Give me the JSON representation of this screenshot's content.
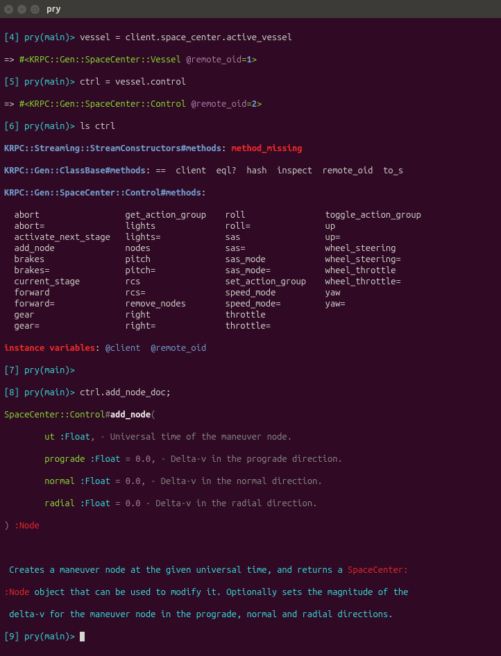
{
  "window": {
    "title": "pry"
  },
  "lines": {
    "p4": "[4] pry(main)> ",
    "p4cmd": "vessel = client.space_center.active_vessel",
    "r4a": "=> ",
    "r4b": "#<KRPC::Gen::SpaceCenter::Vessel ",
    "r4c": "@remote_oid",
    "r4d": "=",
    "r4e": "1",
    "r4f": ">",
    "p5": "[5] pry(main)> ",
    "p5cmd": "ctrl = vessel.control",
    "r5a": "=> ",
    "r5b": "#<KRPC::Gen::SpaceCenter::Control ",
    "r5c": "@remote_oid",
    "r5d": "=",
    "r5e": "2",
    "r5f": ">",
    "p6": "[6] pry(main)> ",
    "p6cmd": "ls ctrl",
    "h1a": "KRPC::Streaming::StreamConstructors#methods",
    "h1b": ": ",
    "h1c": "method_missing",
    "h2a": "KRPC::Gen::ClassBase#methods",
    "h2b": ": ",
    "h2c": "==  client  eql?  hash  inspect  remote_oid  to_s",
    "h3a": "KRPC::Gen::SpaceCenter::Control#methods",
    "h3b": ": ",
    "iva": "instance variables",
    "ivb": ": ",
    "ivc": "@client",
    "ivd": "@remote_oid",
    "p7": "[7] pry(main)> ",
    "p8": "[8] pry(main)> ",
    "p8cmd": "ctrl.add_node_doc;",
    "doc1a": "SpaceCenter::Control",
    "doc1b": "#",
    "doc1c": "add_node",
    "doc1d": "(",
    "pa1a": "        ut ",
    "pa1b": ":Float",
    "pa1c": ", - Universal time of the maneuver node.",
    "pa2a": "        prograde ",
    "pa2b": ":Float",
    "pa2c": " = ",
    "pa2d": "0.0",
    "pa2e": ", - Delta-v in the prograde direction.",
    "pa3a": "        normal ",
    "pa3b": ":Float",
    "pa3c": " = ",
    "pa3d": "0.0",
    "pa3e": ", - Delta-v in the normal direction.",
    "pa4a": "        radial ",
    "pa4b": ":Float",
    "pa4c": " = ",
    "pa4d": "0.0",
    "pa4e": " - Delta-v in the radial direction.",
    "ret1": ") ",
    "ret2": ":Node",
    "desc1": " Creates a maneuver node at the given universal time, and returns a ",
    "desc1b": "SpaceCenter:",
    "desc2a": ":Node",
    "desc2b": " object that can be used to modify it. Optionally sets the magnitude of the",
    "desc3": " delta-v for the maneuver node in the prograde, normal and radial directions.",
    "p9": "[9] pry(main)> "
  },
  "methods": [
    [
      "abort",
      "get_action_group",
      "roll",
      "toggle_action_group"
    ],
    [
      "abort=",
      "lights",
      "roll=",
      "up"
    ],
    [
      "activate_next_stage",
      "lights=",
      "sas",
      "up="
    ],
    [
      "add_node",
      "nodes",
      "sas=",
      "wheel_steering"
    ],
    [
      "brakes",
      "pitch",
      "sas_mode",
      "wheel_steering="
    ],
    [
      "brakes=",
      "pitch=",
      "sas_mode=",
      "wheel_throttle"
    ],
    [
      "current_stage",
      "rcs",
      "set_action_group",
      "wheel_throttle="
    ],
    [
      "forward",
      "rcs=",
      "speed_mode",
      "yaw"
    ],
    [
      "forward=",
      "remove_nodes",
      "speed_mode=",
      "yaw="
    ],
    [
      "gear",
      "right",
      "throttle",
      ""
    ],
    [
      "gear=",
      "right=",
      "throttle=",
      ""
    ]
  ]
}
